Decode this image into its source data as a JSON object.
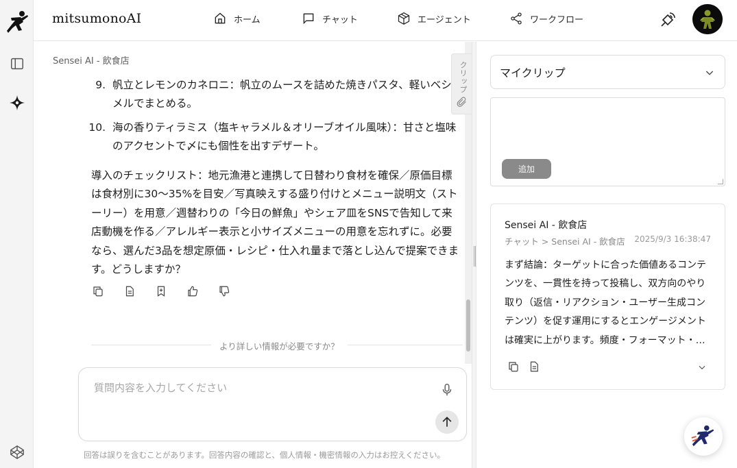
{
  "brand": {
    "name": "mitsumonoAI"
  },
  "nav": [
    {
      "label": "ホーム",
      "icon": "home-icon"
    },
    {
      "label": "チャット",
      "icon": "chat-bubble-icon"
    },
    {
      "label": "エージェント",
      "icon": "cube-icon"
    },
    {
      "label": "ワークフロー",
      "icon": "share-nodes-icon"
    }
  ],
  "chat": {
    "breadcrumb": "Sensei AI - 飲食店",
    "items": [
      {
        "num": "9.",
        "text": "帆立とレモンのカネロニ：帆立のムースを詰めた焼きパスタ、軽いベシャメルでまとめる。"
      },
      {
        "num": "10.",
        "text": "海の香りティラミス（塩キャラメル＆オリーブオイル風味）：甘さと塩味のアクセントで〆にも個性を出すデザート。"
      }
    ],
    "summary": "導入のチェックリスト：地元漁港と連携して日替わり食材を確保／原価目標は食材別に30〜35%を目安／写真映えする盛り付けとメニュー説明文（ストーリー）を用意／週替わりの「今日の鮮魚」やシェア皿をSNSで告知して来店動機を作る／アレルギー表示と小サイズメニューの用意を忘れずに。必要なら、選んだ3品を想定原価・レシピ・仕入れ量まで落とし込んで提案できます。どうしますか？",
    "divider_label": "より詳しい情報が必要ですか？",
    "input_placeholder": "質問内容を入力してください",
    "disclaimer": "回答は誤りを含むことがあります。回答内容の確認と、個人情報・機密情報の入力はお控えください。",
    "clip_tab_label": "クリップ"
  },
  "panel": {
    "select_value": "マイクリップ",
    "add_label": "追加",
    "card": {
      "title": "Sensei AI - 飲食店",
      "path": "チャット > Sensei AI - 飲食店",
      "date": "2025/9/3 16:38:47",
      "body": "まず結論：ターゲットに合った価値あるコンテンツを、一貫性を持って投稿し、双方向のやり取り（返信・リアクション・ユーザー生成コンテンツ）を促す運用にするとエンゲージメントは確実に上がります。頻度・フォーマット・…"
    }
  },
  "colors": {
    "accent": "#1e2a6b",
    "muted": "#8a8a8a"
  }
}
